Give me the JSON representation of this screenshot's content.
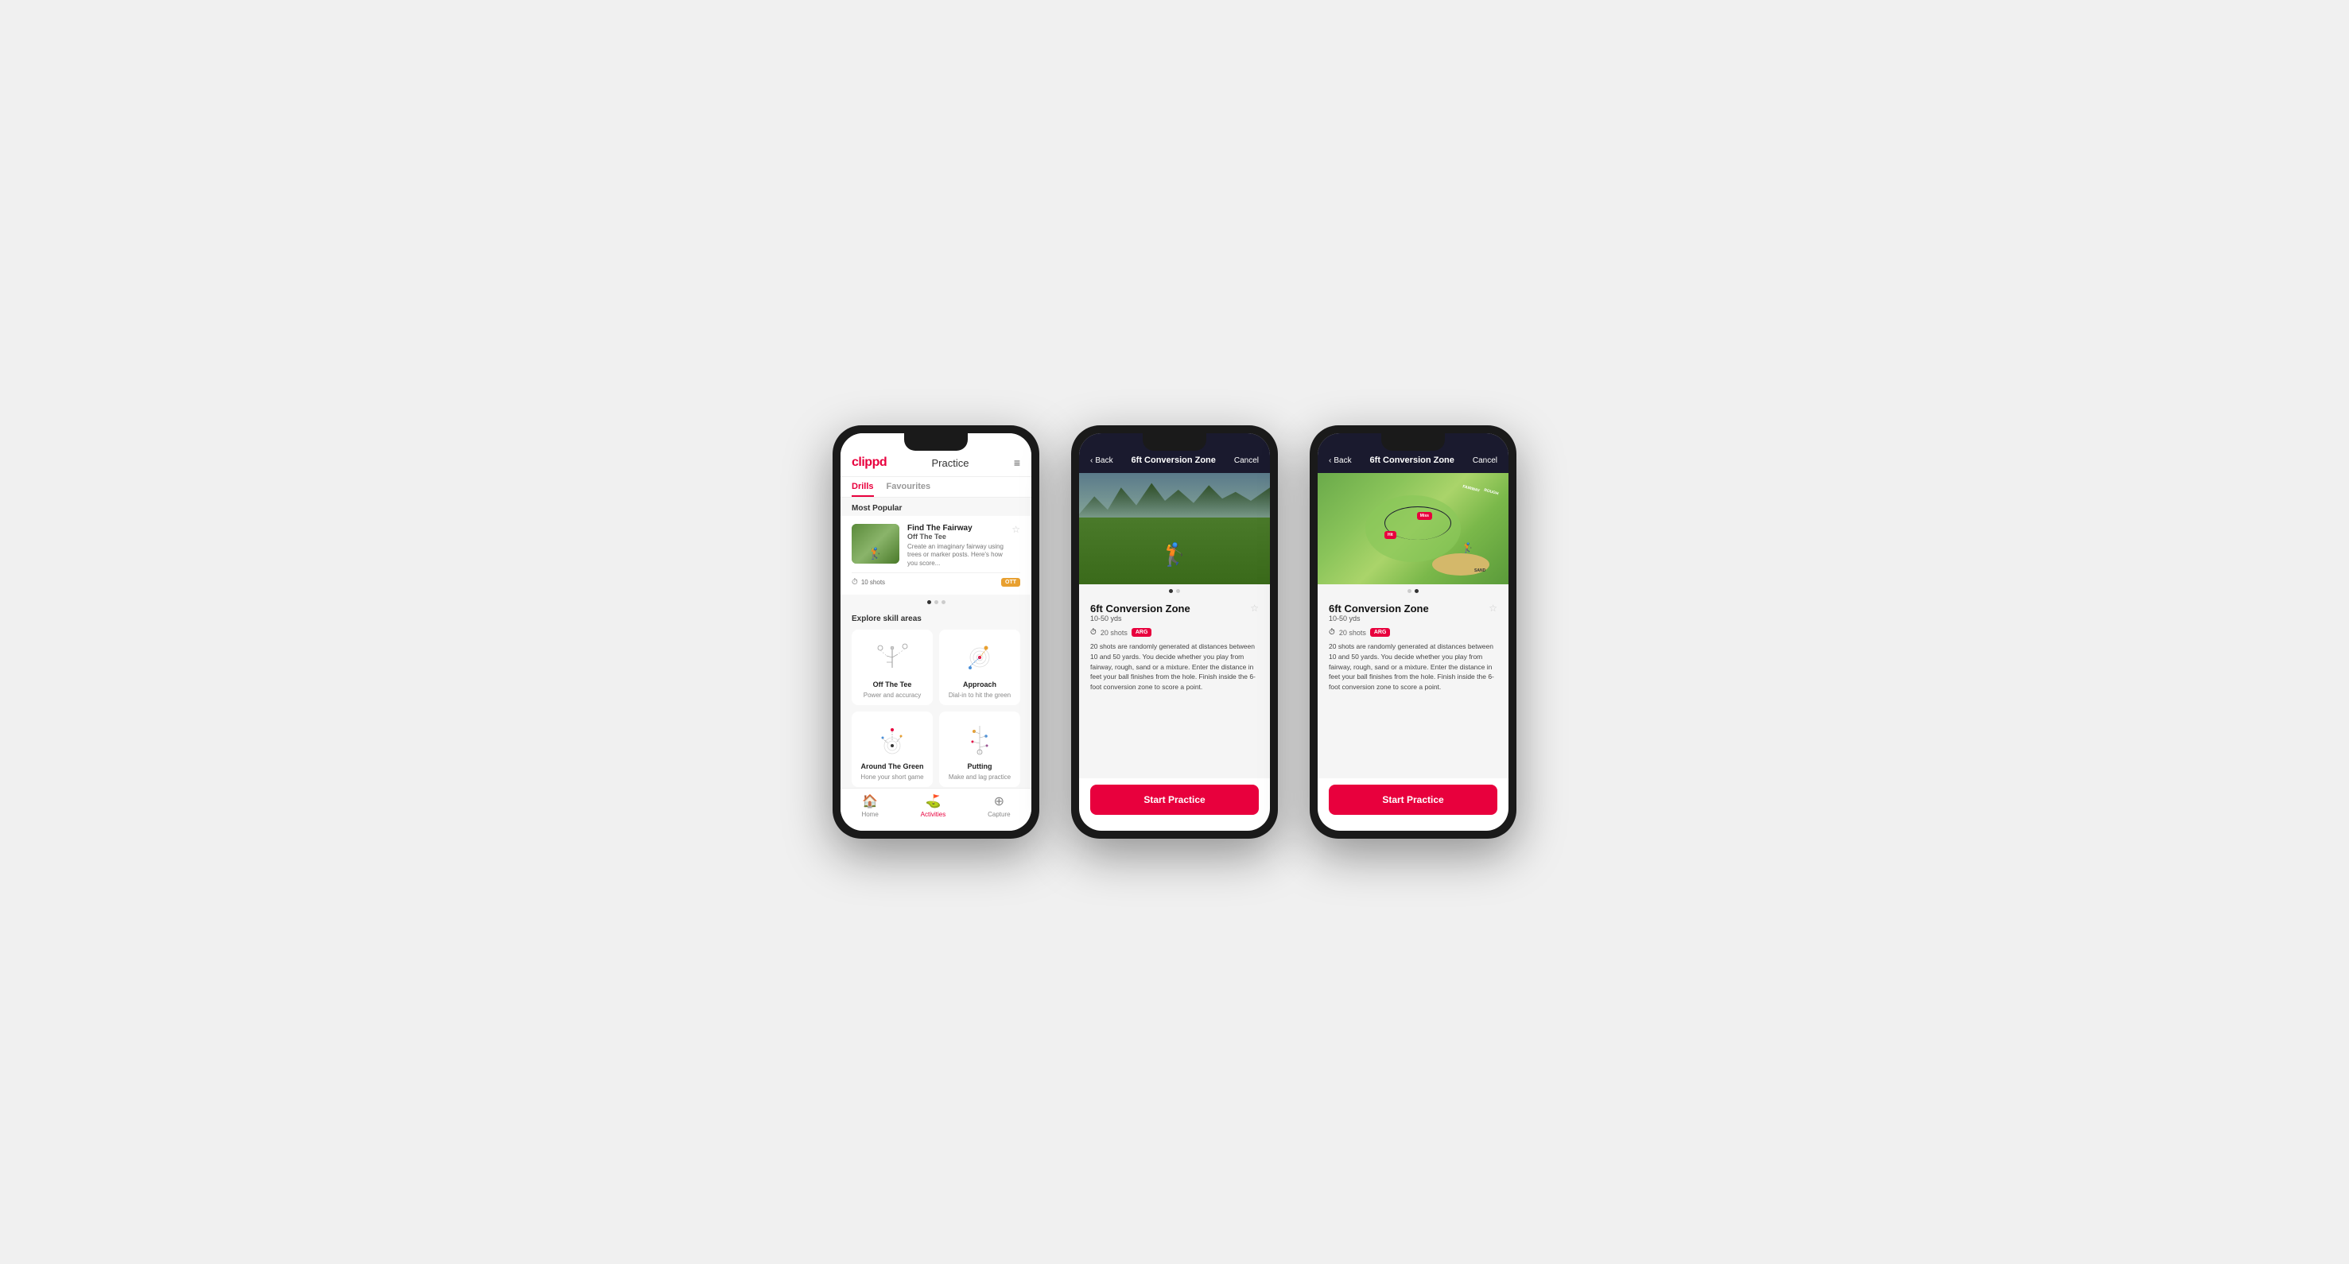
{
  "phone1": {
    "logo": "clippd",
    "header_title": "Practice",
    "menu_icon": "≡",
    "tabs": [
      {
        "label": "Drills",
        "active": true
      },
      {
        "label": "Favourites",
        "active": false
      }
    ],
    "most_popular_label": "Most Popular",
    "featured_drill": {
      "title": "Find The Fairway",
      "subtitle": "Off The Tee",
      "desc": "Create an imaginary fairway using trees or marker posts. Here's how you score...",
      "shots": "10 shots",
      "tag": "OTT"
    },
    "dots": [
      "active",
      "inactive",
      "inactive"
    ],
    "explore_label": "Explore skill areas",
    "skill_areas": [
      {
        "name": "Off The Tee",
        "desc": "Power and accuracy"
      },
      {
        "name": "Approach",
        "desc": "Dial-in to hit the green"
      },
      {
        "name": "Around The Green",
        "desc": "Hone your short game"
      },
      {
        "name": "Putting",
        "desc": "Make and lag practice"
      }
    ],
    "nav": [
      {
        "icon": "🏠",
        "label": "Home",
        "active": false
      },
      {
        "icon": "⛳",
        "label": "Activities",
        "active": true
      },
      {
        "icon": "⊕",
        "label": "Capture",
        "active": false
      }
    ]
  },
  "phone2": {
    "back_label": "Back",
    "header_title": "6ft Conversion Zone",
    "cancel_label": "Cancel",
    "drill_title": "6ft Conversion Zone",
    "drill_range": "10-50 yds",
    "shots": "20 shots",
    "tag": "ARG",
    "desc": "20 shots are randomly generated at distances between 10 and 50 yards. You decide whether you play from fairway, rough, sand or a mixture. Enter the distance in feet your ball finishes from the hole. Finish inside the 6-foot conversion zone to score a point.",
    "dots": [
      "active",
      "inactive"
    ],
    "start_label": "Start Practice"
  },
  "phone3": {
    "back_label": "Back",
    "header_title": "6ft Conversion Zone",
    "cancel_label": "Cancel",
    "drill_title": "6ft Conversion Zone",
    "drill_range": "10-50 yds",
    "shots": "20 shots",
    "tag": "ARG",
    "desc": "20 shots are randomly generated at distances between 10 and 50 yards. You decide whether you play from fairway, rough, sand or a mixture. Enter the distance in feet your ball finishes from the hole. Finish inside the 6-foot conversion zone to score a point.",
    "dots": [
      "inactive",
      "active"
    ],
    "start_label": "Start Practice",
    "map_labels": {
      "hit": "Hit",
      "miss": "Miss",
      "fairway": "FAIRWAY",
      "rough": "ROUGH",
      "sand": "SAND"
    }
  }
}
